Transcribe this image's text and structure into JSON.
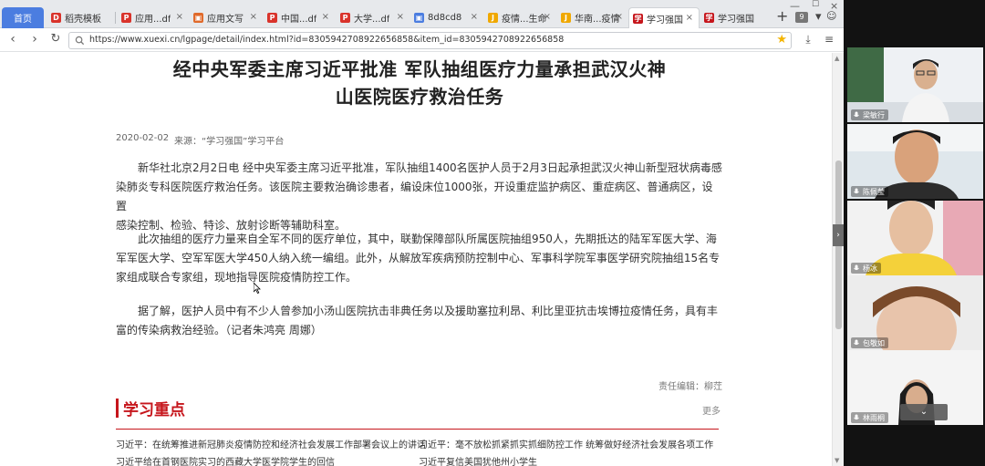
{
  "tabs": [
    {
      "label": "首页",
      "icon": "home-tab",
      "color": "#4b7de0"
    },
    {
      "label": "稻壳模板",
      "icon": "docer-icon",
      "color": "#d9332b"
    },
    {
      "label": "应用...df",
      "icon": "pdf-icon",
      "color": "#d9332b"
    },
    {
      "label": "应用文写",
      "icon": "image-icon",
      "color": "#e06a2b"
    },
    {
      "label": "中国...df",
      "icon": "pdf-icon",
      "color": "#d9332b"
    },
    {
      "label": "大学...df",
      "icon": "pdf-icon",
      "color": "#d9332b"
    },
    {
      "label": "8d8cd8",
      "icon": "image-icon",
      "color": "#4b7de0"
    },
    {
      "label": "疫情...生命",
      "icon": "page-icon",
      "color": "#f0a800"
    },
    {
      "label": "华南...疫情",
      "icon": "page-icon",
      "color": "#f0a800"
    },
    {
      "label": "学习强国",
      "icon": "xuexi-icon",
      "color": "#c6161c"
    },
    {
      "label": "学习强国",
      "icon": "xuexi-icon",
      "color": "#c6161c"
    }
  ],
  "toolbar": {
    "tab_count": "9"
  },
  "address": {
    "url": "https://www.xuexi.cn/lgpage/detail/index.html?id=8305942708922656858&item_id=8305942708922656858"
  },
  "article": {
    "title_line1": "经中央军委主席习近平批准 军队抽组医疗力量承担武汉火神",
    "title_line2": "山医院医疗救治任务",
    "date": "2020-02-02",
    "source": "来源：“学习强国”学习平台",
    "paragraphs": [
      [
        "新华社北京2月2日电 经中央军委主席习近平批准，军队抽组1400名医护人员于2月3日起承担武汉火神山新型冠状病毒感",
        "染肺炎专科医院医疗救治任务。该医院主要救治确诊患者，编设床位1000张，开设重症监护病区、重症病区、普通病区，设置",
        "感染控制、检验、特诊、放射诊断等辅助科室。"
      ],
      [
        "此次抽组的医疗力量来自全军不同的医疗单位，其中，联勤保障部队所属医院抽组950人，先期抵达的陆军军医大学、海",
        "军军医大学、空军军医大学450人纳入统一编组。此外，从解放军疾病预防控制中心、军事科学院军事医学研究院抽组15名专",
        "家组成联合专家组，现地指导医院疫情防控工作。"
      ],
      [
        "据了解，医护人员中有不少人曾参加小汤山医院抗击非典任务以及援助塞拉利昂、利比里亚抗击埃博拉疫情任务，具有丰",
        "富的传染病救治经验。（记者朱鸿亮 周娜）"
      ]
    ],
    "editor": "责任编辑：柳茳"
  },
  "section": {
    "heading": "学习重点",
    "more": "更多",
    "links": [
      "习近平：在统筹推进新冠肺炎疫情防控和经济社会发展工作部署会议上的讲话",
      "习近平：毫不放松抓紧抓实抓细防控工作 统筹做好经济社会发展各项工作",
      "习近平给在首钢医院实习的西藏大学医学院学生的回信",
      "习近平复信美国犹他州小学生"
    ]
  },
  "participants": [
    "梁敏行",
    "陈佩莹",
    "杨冰",
    "包敬如",
    "林雨桐"
  ],
  "colors": {
    "accent": "#c6161c",
    "tab_active": "#4b7de0"
  }
}
